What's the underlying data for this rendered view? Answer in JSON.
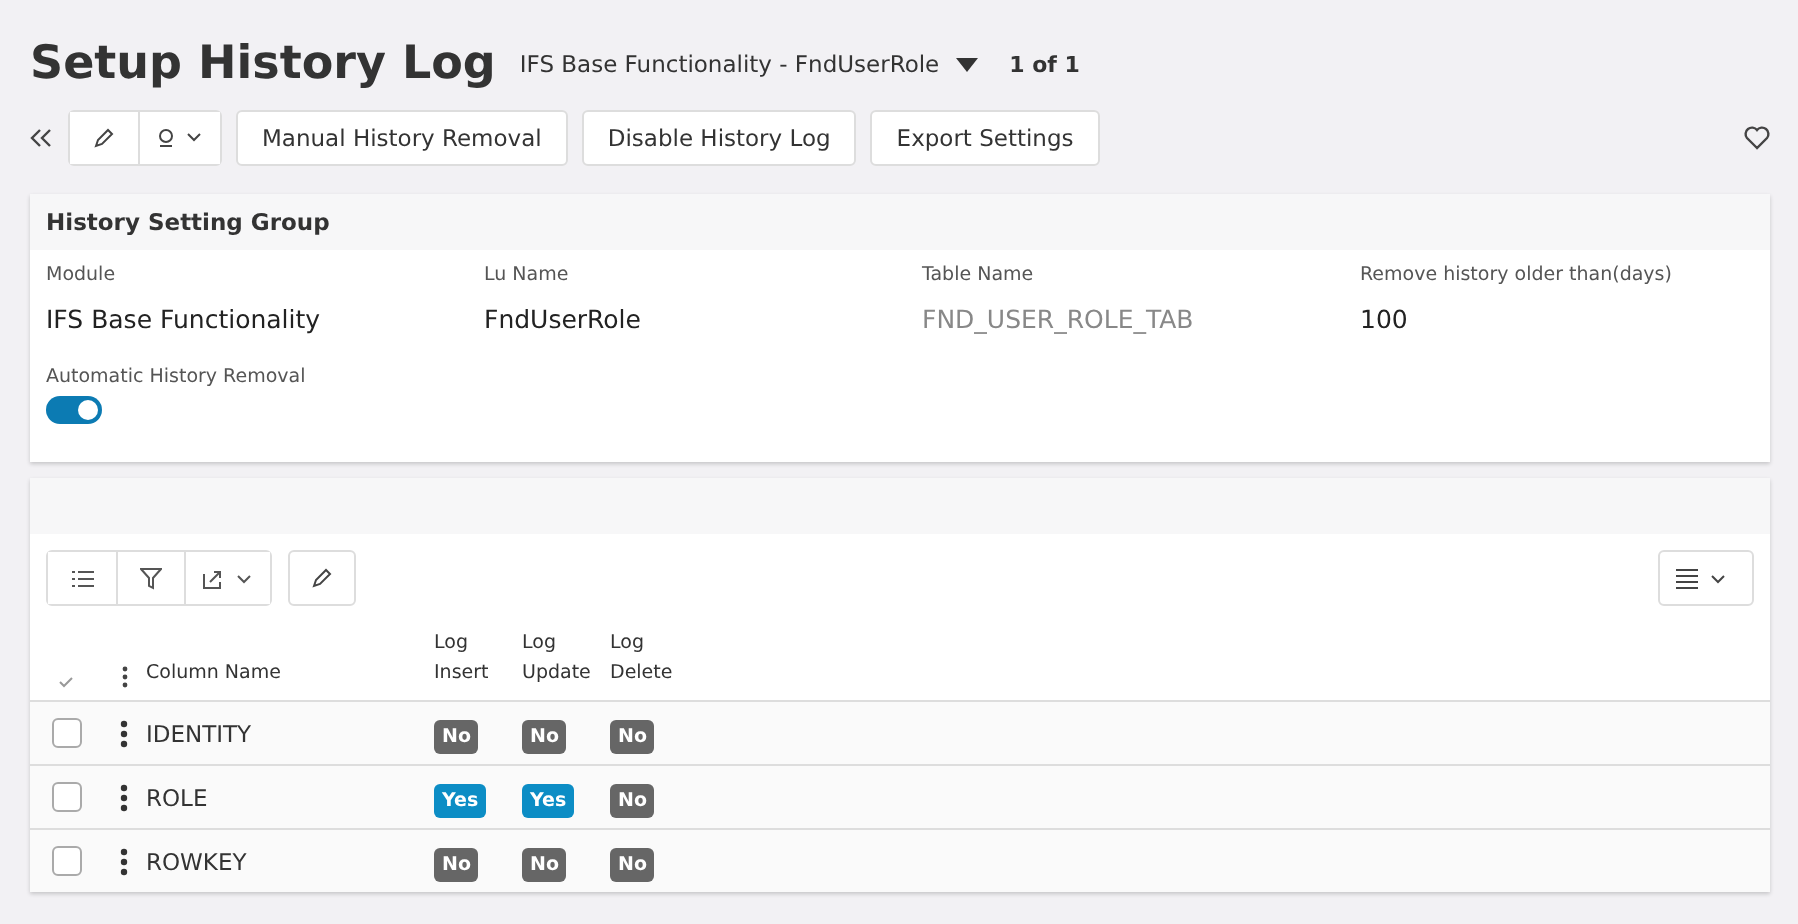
{
  "header": {
    "title": "Setup History Log",
    "record": "IFS Base Functionality - FndUserRole",
    "pager": "1 of 1"
  },
  "toolbar": {
    "buttons": [
      "Manual History Removal",
      "Disable History Log",
      "Export Settings"
    ]
  },
  "group": {
    "title": "History Setting Group",
    "fields": [
      {
        "label": "Module",
        "value": "IFS Base Functionality",
        "readonly": false
      },
      {
        "label": "Lu Name",
        "value": "FndUserRole",
        "readonly": false
      },
      {
        "label": "Table Name",
        "value": "FND_USER_ROLE_TAB",
        "readonly": true
      },
      {
        "label": "Remove history older than(days)",
        "value": "100",
        "readonly": false
      }
    ],
    "toggle": {
      "label": "Automatic History Removal",
      "on": true
    }
  },
  "table": {
    "columns": [
      "Column Name",
      "Log Insert",
      "Log Update",
      "Log Delete"
    ],
    "rows": [
      {
        "checked": false,
        "name": "IDENTITY",
        "flags": [
          {
            "text": "No",
            "on": false
          },
          {
            "text": "No",
            "on": false
          },
          {
            "text": "No",
            "on": false
          }
        ]
      },
      {
        "checked": false,
        "name": "ROLE",
        "flags": [
          {
            "text": "Yes",
            "on": true
          },
          {
            "text": "Yes",
            "on": true
          },
          {
            "text": "No",
            "on": false
          }
        ]
      },
      {
        "checked": false,
        "name": "ROWKEY",
        "flags": [
          {
            "text": "No",
            "on": false
          },
          {
            "text": "No",
            "on": false
          },
          {
            "text": "No",
            "on": false
          }
        ]
      }
    ]
  }
}
